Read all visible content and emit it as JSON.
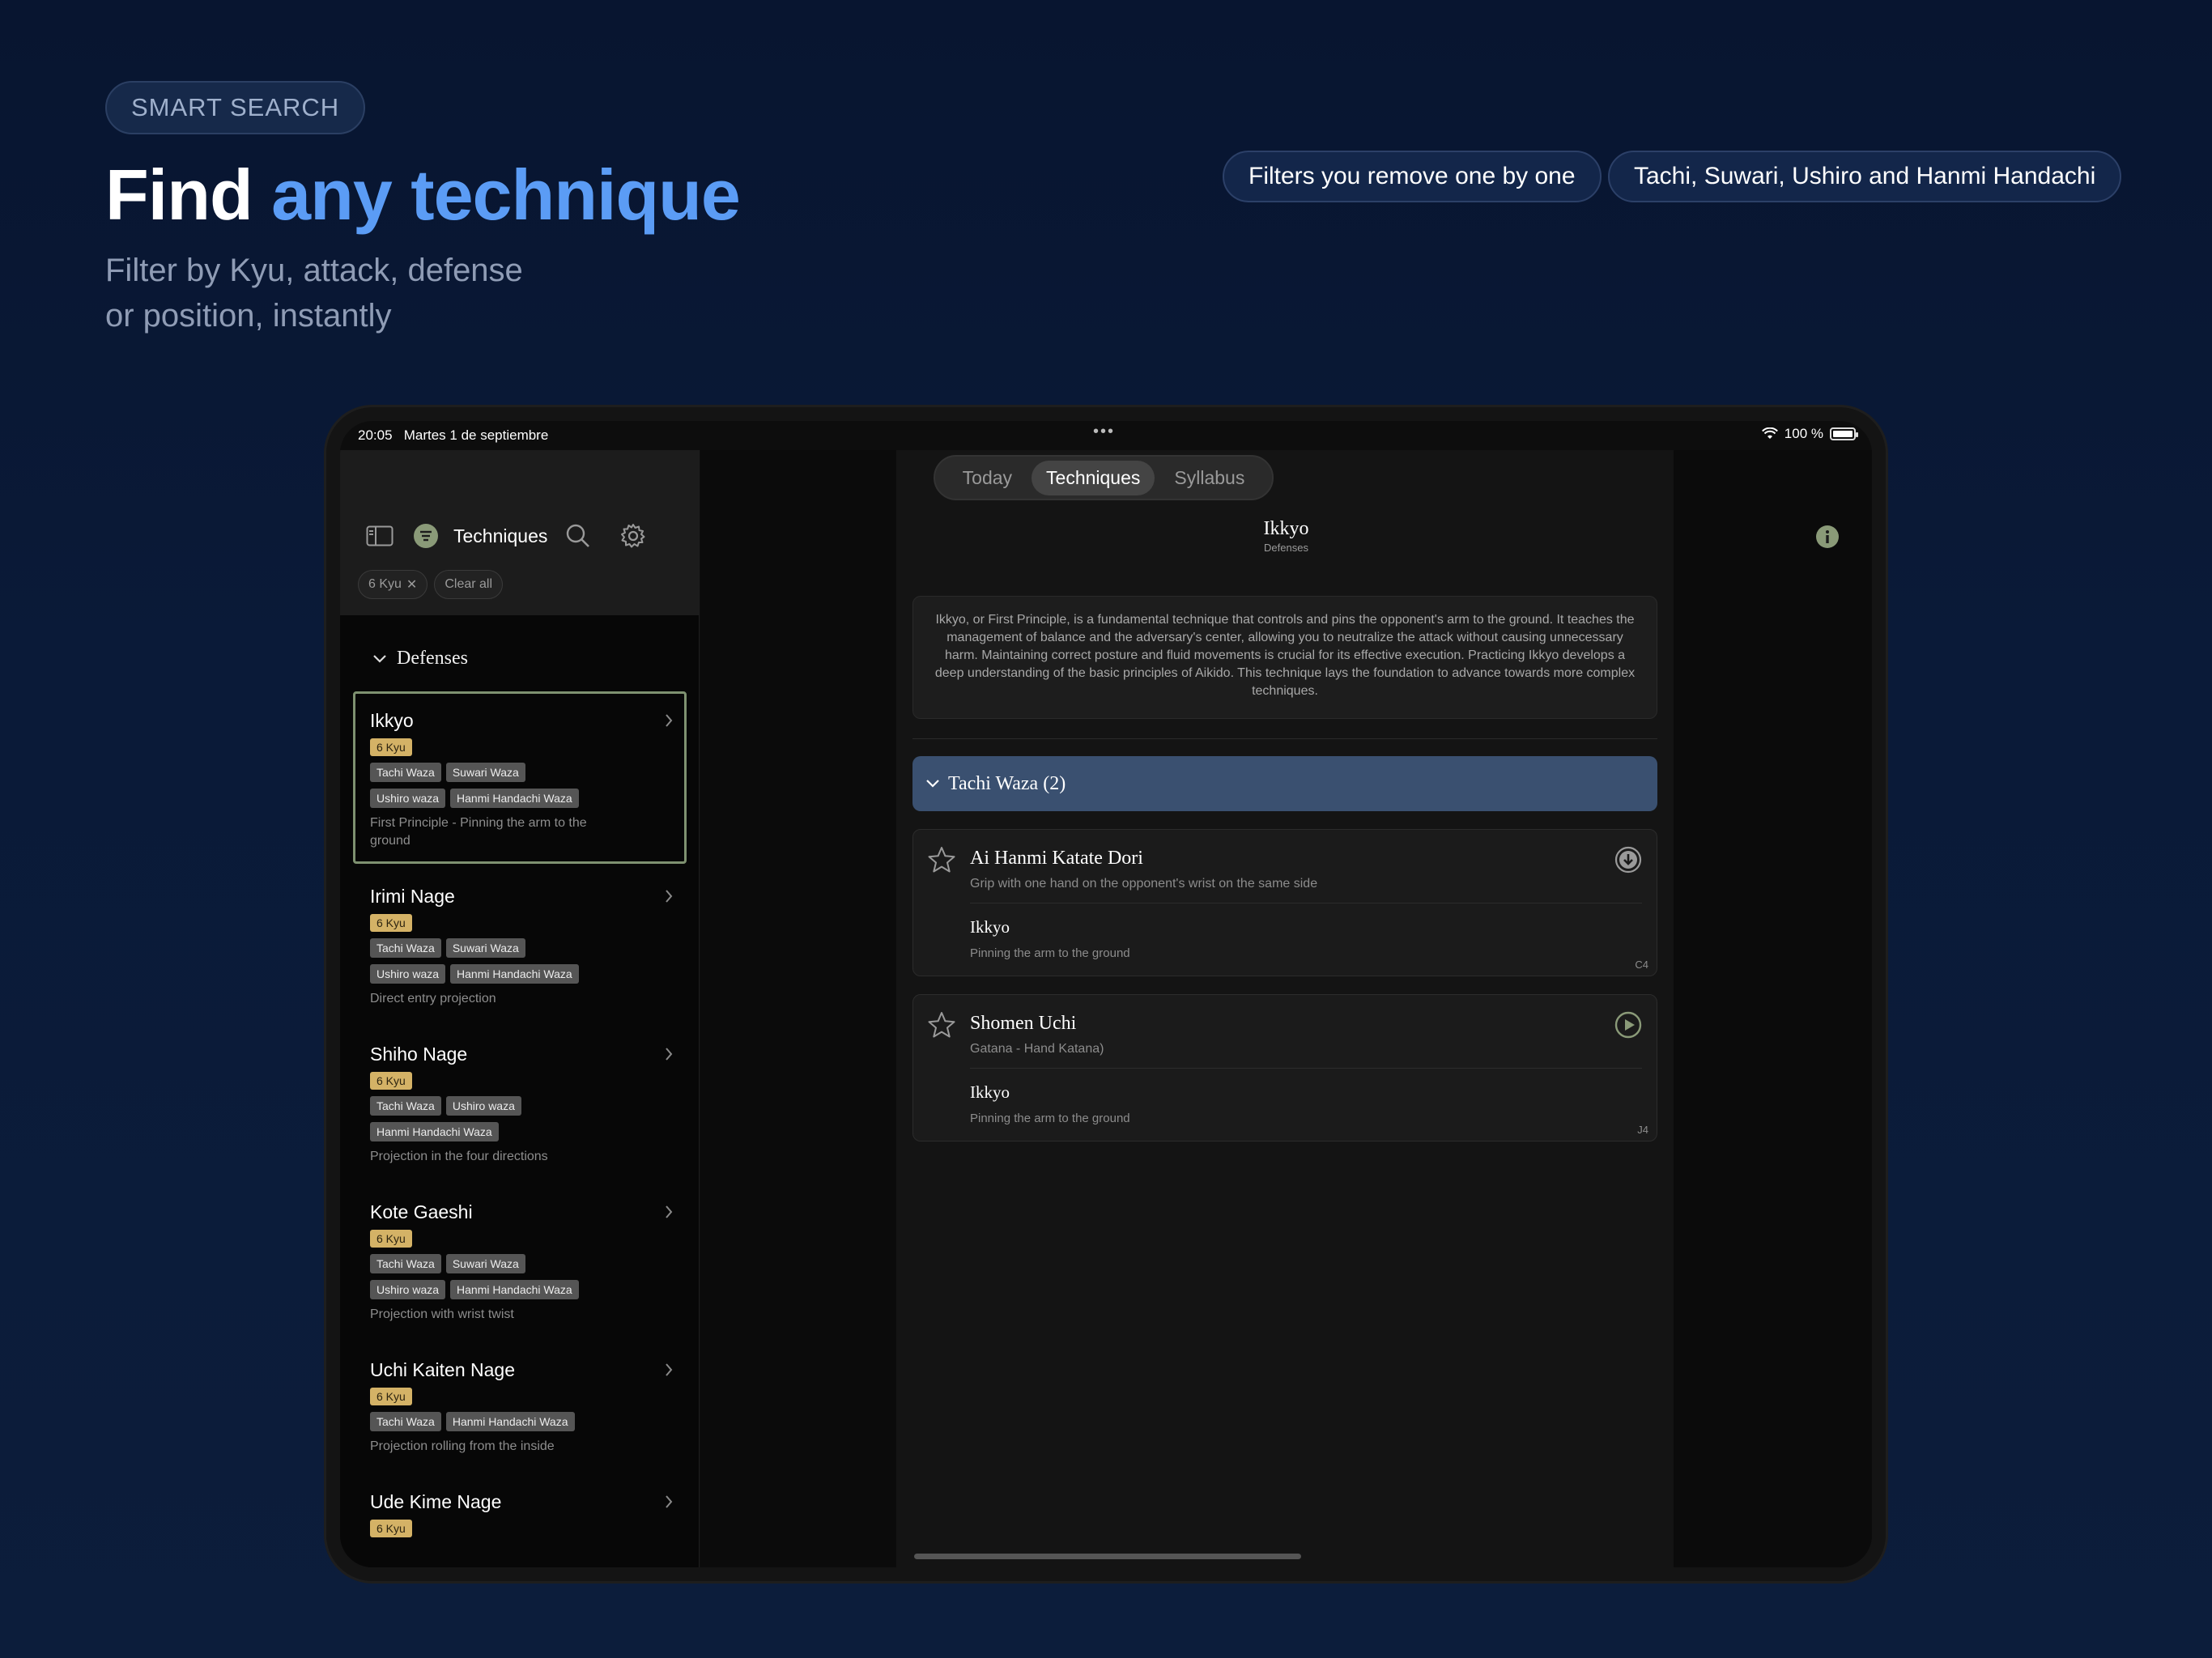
{
  "hero": {
    "badge": "SMART SEARCH",
    "title_plain": "Find ",
    "title_accent": "any technique",
    "subtitle_line1": "Filter by Kyu, attack, defense",
    "subtitle_line2": "or position, instantly",
    "pills": [
      "Filters you remove one by one",
      "Tachi, Suwari, Ushiro and Hanmi Handachi"
    ],
    "accent_color": "#5b9cf5"
  },
  "statusbar": {
    "time": "20:05",
    "date": "Martes 1 de septiembre",
    "battery": "100 %",
    "battery_level": 1.0
  },
  "sidebar": {
    "title": "Techniques",
    "chips": {
      "active_filter": "6 Kyu",
      "clear": "Clear all"
    },
    "section": "Defenses",
    "techniques": [
      {
        "name": "Ikkyo",
        "kyu": "6 Kyu",
        "tags": [
          "Tachi Waza",
          "Suwari Waza",
          "Ushiro waza",
          "Hanmi Handachi Waza"
        ],
        "desc": "First Principle - Pinning the arm to the ground"
      },
      {
        "name": "Irimi Nage",
        "kyu": "6 Kyu",
        "tags": [
          "Tachi Waza",
          "Suwari Waza",
          "Ushiro waza",
          "Hanmi Handachi Waza"
        ],
        "desc": "Direct entry projection"
      },
      {
        "name": "Shiho Nage",
        "kyu": "6 Kyu",
        "tags": [
          "Tachi Waza",
          "Ushiro waza",
          "Hanmi Handachi Waza"
        ],
        "desc": "Projection in the four directions"
      },
      {
        "name": "Kote Gaeshi",
        "kyu": "6 Kyu",
        "tags": [
          "Tachi Waza",
          "Suwari Waza",
          "Ushiro waza",
          "Hanmi Handachi Waza"
        ],
        "desc": "Projection with wrist twist"
      },
      {
        "name": "Uchi Kaiten Nage",
        "kyu": "6 Kyu",
        "tags": [
          "Tachi Waza",
          "Hanmi Handachi Waza"
        ],
        "desc": "Projection rolling from the inside"
      },
      {
        "name": "Ude Kime Nage",
        "kyu": "6 Kyu",
        "tags": [],
        "desc": ""
      }
    ]
  },
  "main": {
    "tabs": [
      "Today",
      "Techniques",
      "Syllabus"
    ],
    "active_tab": "Techniques",
    "title": "Ikkyo",
    "subtitle": "Defenses",
    "description": "Ikkyo, or First Principle, is a fundamental technique that controls and pins the opponent's arm to the ground. It teaches the management of balance and the adversary's center, allowing you to neutralize the attack without causing unnecessary harm. Maintaining correct posture and fluid movements is crucial for its effective execution. Practicing Ikkyo develops a deep understanding of the basic principles of Aikido. This technique lays the foundation to advance towards more complex techniques.",
    "group": "Tachi Waza (2)",
    "cards": [
      {
        "title": "Ai Hanmi Katate Dori",
        "subtitle": "Grip with one hand on the opponent's wrist on the same side",
        "defense": "Ikkyo",
        "defense_desc": "Pinning the arm to the ground",
        "code": "C4",
        "action_icon": "download-icon"
      },
      {
        "title": "Shomen Uchi",
        "subtitle": "Gatana - Hand Katana)",
        "defense": "Ikkyo",
        "defense_desc": "Pinning the arm to the ground",
        "code": "J4",
        "action_icon": "play-icon"
      }
    ]
  }
}
